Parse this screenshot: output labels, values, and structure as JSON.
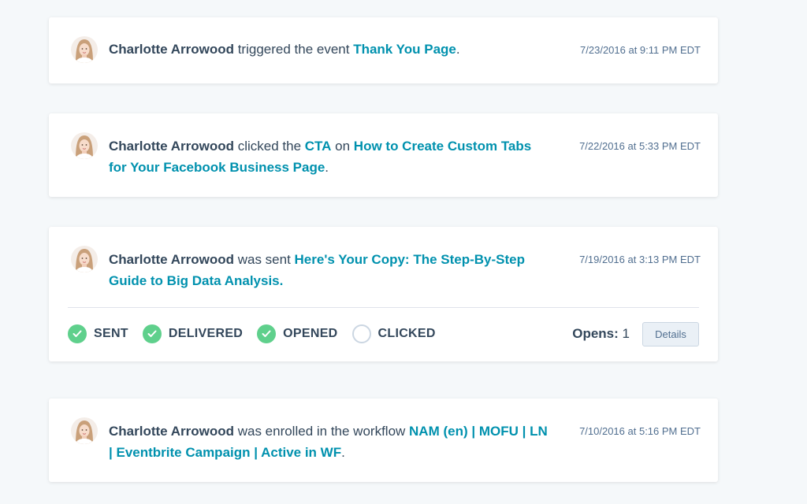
{
  "events": [
    {
      "name": "Charlotte Arrowood",
      "segments": [
        " triggered the event ",
        "Thank You Page",
        "."
      ],
      "timestamp": "7/23/2016 at 9:11 PM EDT"
    },
    {
      "name": "Charlotte Arrowood",
      "segments": [
        " clicked the ",
        "CTA",
        " on ",
        "How to Create Custom Tabs for Your Facebook Business Page",
        "."
      ],
      "timestamp": "7/22/2016 at 5:33 PM EDT"
    },
    {
      "name": "Charlotte Arrowood",
      "segments": [
        " was sent ",
        "Here's Your Copy: The Step-By-Step Guide to Big Data Analysis."
      ],
      "timestamp": "7/19/2016 at 3:13 PM EDT",
      "email_status": {
        "steps": [
          {
            "label": "SENT",
            "done": true
          },
          {
            "label": "DELIVERED",
            "done": true
          },
          {
            "label": "OPENED",
            "done": true
          },
          {
            "label": "CLICKED",
            "done": false
          }
        ],
        "opens_label": "Opens:",
        "opens_count": "1",
        "details_label": "Details"
      }
    },
    {
      "name": "Charlotte Arrowood",
      "segments": [
        " was enrolled in the workflow ",
        "NAM (en) | MOFU | LN | Eventbrite Campaign | Active in WF",
        "."
      ],
      "timestamp": "7/10/2016 at 5:16 PM EDT"
    }
  ],
  "colors": {
    "link": "#0091ae",
    "text": "#33475b",
    "status_done": "#5fd08c",
    "background": "#f5f8fa"
  }
}
